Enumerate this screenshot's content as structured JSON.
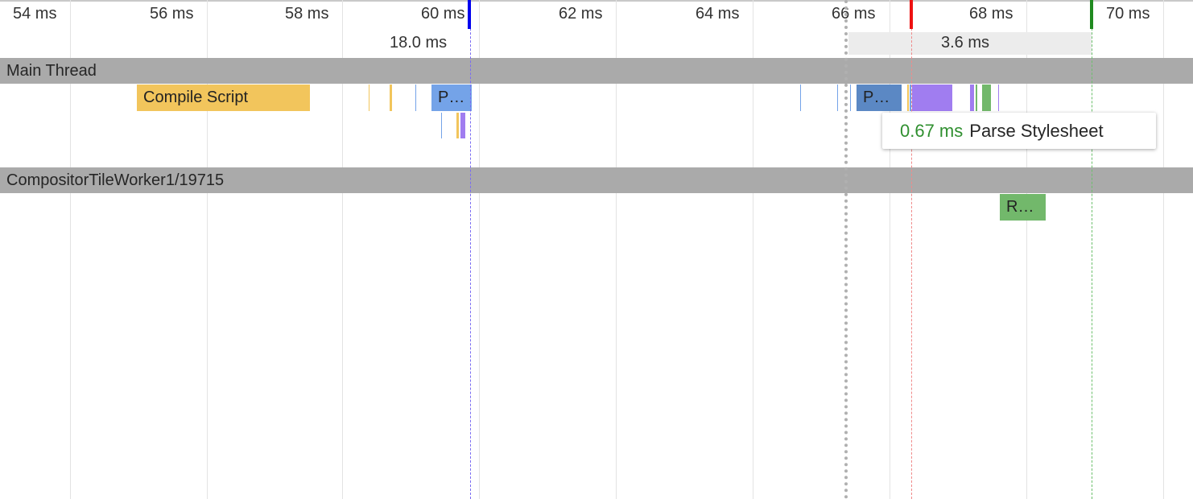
{
  "ruler": {
    "ticks": [
      "54 ms",
      "56 ms",
      "58 ms",
      "60 ms",
      "62 ms",
      "64 ms",
      "66 ms",
      "68 ms",
      "70 ms"
    ],
    "range_left_label": "18.0 ms",
    "range_right_label": "3.6 ms"
  },
  "tracks": {
    "main_thread": "Main Thread",
    "compositor": "CompositorTileWorker1/19715"
  },
  "events": {
    "compile_script": "Compile Script",
    "parse_left": "P…",
    "parse_right": "P…",
    "raster": "R…"
  },
  "tooltip": {
    "duration": "0.67 ms",
    "name": "Parse Stylesheet"
  },
  "colors": {
    "scripting": "#f2c55c",
    "loading": "#74a3e8",
    "loading_dark": "#5b88c4",
    "rendering": "#a07df0",
    "painting": "#72b86b",
    "marker_blue": "#0000ee",
    "marker_red": "#ee1111",
    "marker_green": "#1f8a1f"
  }
}
